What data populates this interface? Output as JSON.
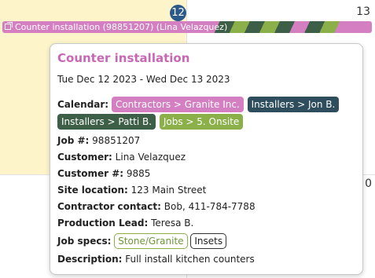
{
  "calendar": {
    "day_today": "12",
    "day_next": "13",
    "day_partial": "0",
    "event_bar_label": "Counter installation (98851207) (Lina Velazquez)"
  },
  "popover": {
    "title": "Counter installation",
    "date_range": "Tue Dec 12 2023 - Wed Dec 13 2023",
    "calendar_label": "Calendar:",
    "calendars": [
      {
        "label": "Contractors > Granite Inc.",
        "color": "#d47fc2"
      },
      {
        "label": "Installers > Jon B.",
        "color": "#2e4e5e"
      },
      {
        "label": "Installers > Patti B.",
        "color": "#3d5f48"
      },
      {
        "label": "Jobs > 5. Onsite",
        "color": "#8bb04a"
      }
    ],
    "job_label": "Job #:",
    "job_value": "98851207",
    "customer_label": "Customer:",
    "customer_value": "Lina Velazquez",
    "customer_num_label": "Customer #:",
    "customer_num_value": "9885",
    "site_label": "Site location:",
    "site_value": "123 Main Street",
    "contractor_label": "Contractor contact:",
    "contractor_value": "Bob, 411-784-7788",
    "lead_label": "Production Lead:",
    "lead_value": "Teresa B.",
    "specs_label": "Job specs:",
    "specs": [
      "Stone/Granite",
      "Insets"
    ],
    "description_label": "Description:",
    "description_value": "Full install kitchen counters"
  }
}
